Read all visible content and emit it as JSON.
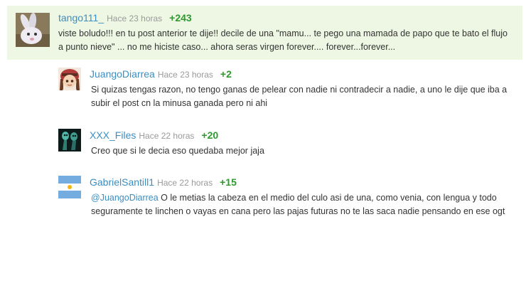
{
  "comments": [
    {
      "user": "tango111_",
      "time": "Hace 23 horas",
      "score": "+243",
      "text": "viste boludo!!! en tu post anterior te dije!! decile de una \"mamu... te pego una mamada de papo que te bato el flujo a punto nieve\" ... no me hiciste caso... ahora seras virgen forever.... forever...forever...",
      "avatar_icon": "rabbit-avatar"
    },
    {
      "user": "JuangoDiarrea",
      "time": "Hace 23 horas",
      "score": "+2",
      "text": "Si quizas tengas razon, no tengo ganas de pelear con nadie ni contradecir a nadie, a uno le dije que iba a subir el post cn la minusa ganada pero ni ahi",
      "avatar_icon": "girl-avatar"
    },
    {
      "user": "XXX_Files",
      "time": "Hace 22 horas",
      "score": "+20",
      "text": "Creo que si le decia eso quedaba mejor jaja",
      "avatar_icon": "alien-avatar"
    },
    {
      "user": "GabrielSantill1",
      "time": "Hace 22 horas",
      "score": "+15",
      "mention": "@JuangoDiarrea",
      "text": " O le metias la cabeza en el medio del culo asi de una, como venia, con lengua y todo seguramente te linchen o vayas en cana pero las pajas futuras no te las saca nadie pensando en ese ogt",
      "avatar_icon": "argentina-flag-avatar"
    }
  ],
  "colors": {
    "highlight_bg": "#eef7e3",
    "username": "#3b8ec2",
    "score": "#2e9a2e",
    "time": "#9a9a9a"
  }
}
